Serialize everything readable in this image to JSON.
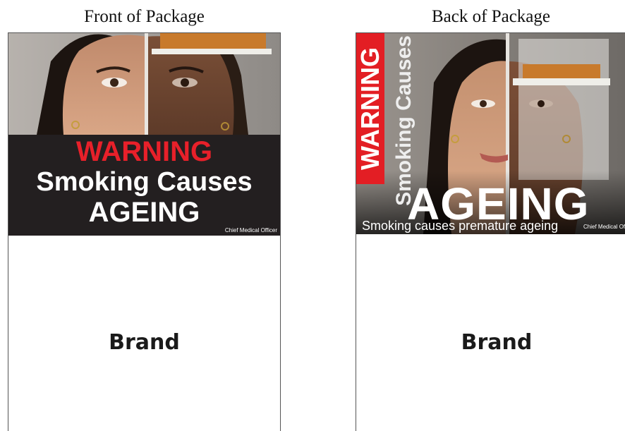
{
  "front": {
    "heading": "Front of Package",
    "warning_line1": "WARNING",
    "warning_line2": "Smoking Causes",
    "warning_line3": "AGEING",
    "attribution": "Chief Medical Officer",
    "brand": "Brand"
  },
  "back": {
    "heading": "Back of Package",
    "warning_vertical": "WARNING",
    "smoking_causes_vertical": "Smoking Causes",
    "ageing": "AGEING",
    "caption": "Smoking causes premature ageing",
    "attribution": "Chief Medical Officer",
    "brand": "Brand"
  },
  "colors": {
    "warning_red": "#e8202a",
    "box_black": "#231f20",
    "text_white": "#ffffff"
  }
}
